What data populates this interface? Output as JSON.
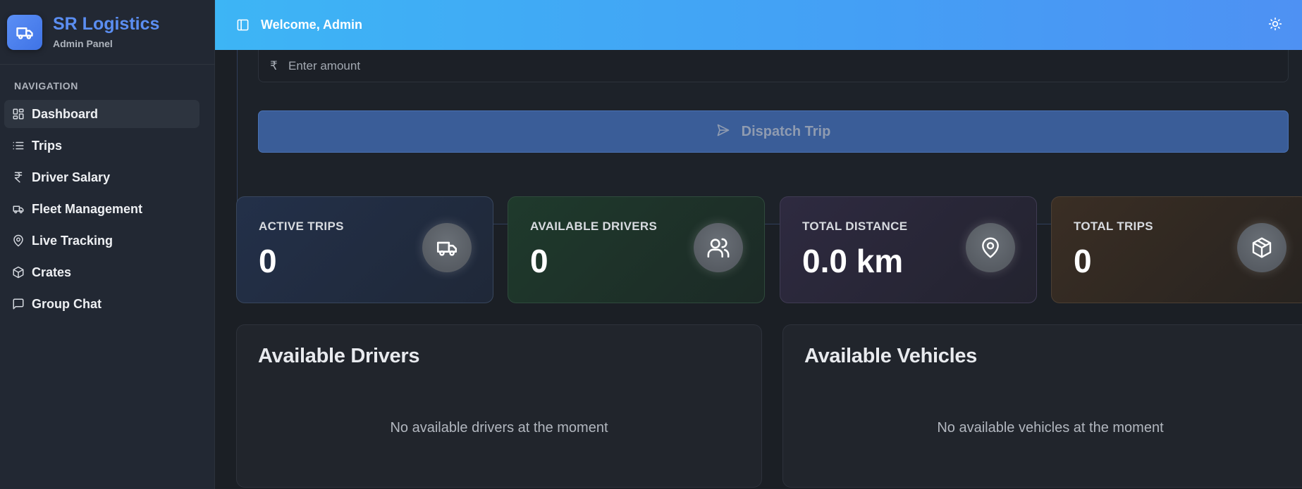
{
  "brand": {
    "title": "SR Logistics",
    "subtitle": "Admin Panel"
  },
  "sidebar": {
    "heading": "NAVIGATION",
    "items": [
      {
        "label": "Dashboard",
        "icon": "dashboard-grid-icon"
      },
      {
        "label": "Trips",
        "icon": "list-icon"
      },
      {
        "label": "Driver Salary",
        "icon": "rupee-icon"
      },
      {
        "label": "Fleet Management",
        "icon": "truck-icon"
      },
      {
        "label": "Live Tracking",
        "icon": "map-pin-icon"
      },
      {
        "label": "Crates",
        "icon": "package-icon"
      },
      {
        "label": "Group Chat",
        "icon": "chat-icon"
      }
    ]
  },
  "header": {
    "welcome": "Welcome, Admin",
    "accent": "#3db5f5"
  },
  "dispatch": {
    "amount_placeholder": "Enter amount",
    "currency_symbol": "₹",
    "button_label": "Dispatch Trip"
  },
  "stats": [
    {
      "label": "ACTIVE TRIPS",
      "value": "0",
      "icon": "truck-icon"
    },
    {
      "label": "AVAILABLE DRIVERS",
      "value": "0",
      "icon": "users-icon"
    },
    {
      "label": "TOTAL DISTANCE",
      "value": "0.0 km",
      "icon": "map-pin-icon"
    },
    {
      "label": "TOTAL TRIPS",
      "value": "0",
      "icon": "package-icon"
    }
  ],
  "panels": {
    "drivers": {
      "title": "Available Drivers",
      "empty": "No available drivers at the moment"
    },
    "vehicles": {
      "title": "Available Vehicles",
      "empty": "No available vehicles at the moment"
    }
  }
}
